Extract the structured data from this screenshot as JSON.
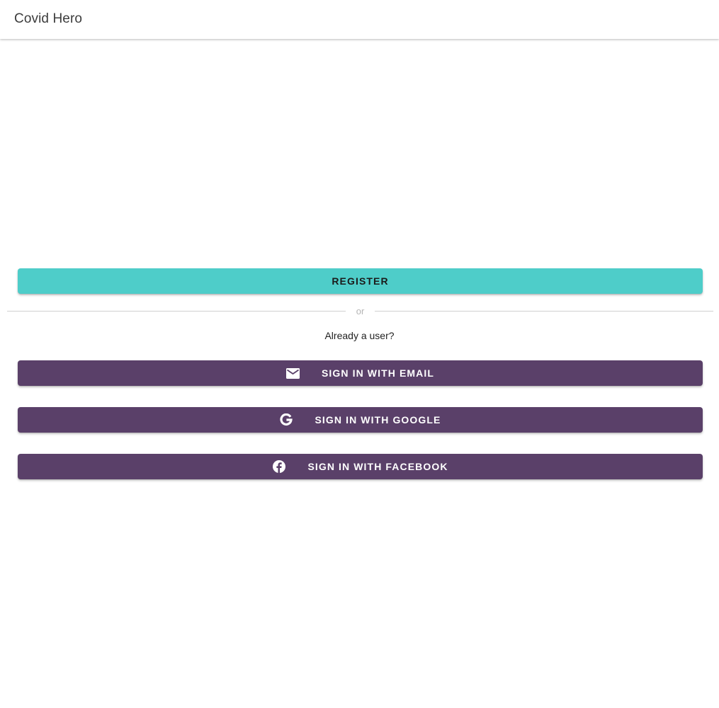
{
  "app": {
    "title": "Covid Hero"
  },
  "register": {
    "label": "REGISTER",
    "color": "#4ecdc9"
  },
  "divider": {
    "text": "or"
  },
  "signin": {
    "prompt": "Already a user?",
    "color": "#5a4069",
    "buttons": [
      {
        "label": "SIGN IN WITH EMAIL",
        "icon": "email-icon"
      },
      {
        "label": "SIGN IN WITH GOOGLE",
        "icon": "google-icon"
      },
      {
        "label": "SIGN IN WITH FACEBOOK",
        "icon": "facebook-icon"
      }
    ]
  }
}
